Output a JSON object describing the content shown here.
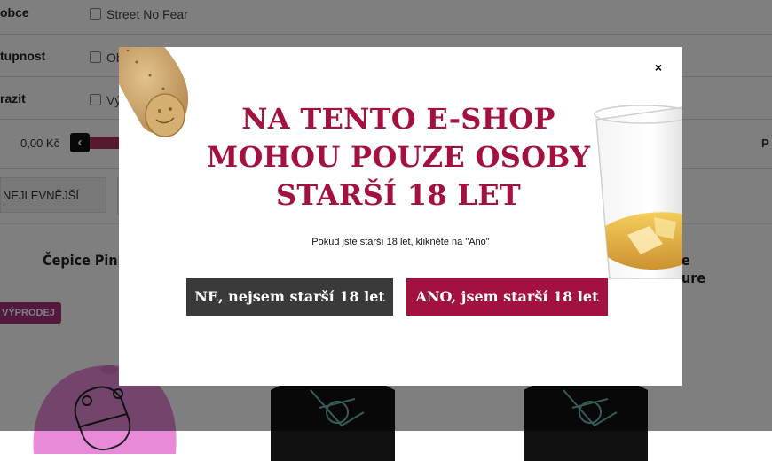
{
  "filters": {
    "rows": [
      {
        "label": "obce",
        "option": "Street No Fear"
      },
      {
        "label": "tupnost",
        "option": "Ob"
      },
      {
        "label": "razit",
        "option": "Vý"
      }
    ],
    "price_min": "0,00 Kč",
    "price_right": "P",
    "slider_fill_fraction": 0.3
  },
  "sort": {
    "label": "NEJLEVNĚJŠÍ"
  },
  "products": {
    "titles": [
      "Čepice Pink",
      "e",
      "ure"
    ],
    "badge": "VÝPRODEJ"
  },
  "modal": {
    "headline_lines": [
      "NA TENTO E-SHOP",
      "MOHOU POUZE OSOBY",
      "STARŠÍ 18 LET"
    ],
    "note": "Pokud jste starší 18 let,  klikněte na \"Ano\"",
    "close_label": "×",
    "no_button": "NE, nejsem starší 18 let",
    "yes_button": "ANO, jsem starší 18 let"
  },
  "colors": {
    "accent": "#a3123f",
    "dark_button": "#3a3a3a",
    "badge": "#a7307a",
    "overlay": "rgba(0,0,0,0.5)"
  },
  "icons": {
    "close": "close-icon",
    "slider_handle": "chevron-left-icon"
  }
}
